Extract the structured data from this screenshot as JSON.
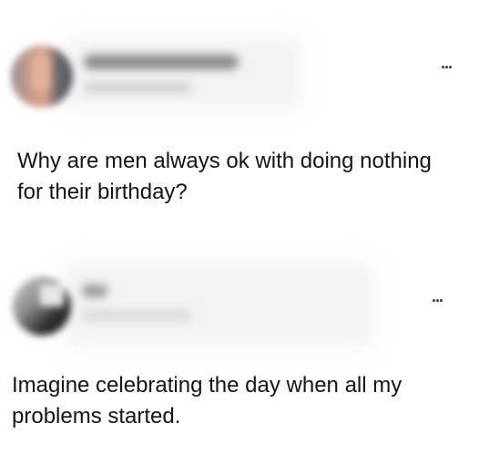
{
  "posts": [
    {
      "text": "Why are men always ok with doing nothing for their birthday?",
      "more_icon": "more-horizontal-icon",
      "more_symbol": "..."
    },
    {
      "text": "Imagine celebrating the day when all my problems started.",
      "more_icon": "more-horizontal-icon",
      "more_symbol": "..."
    }
  ]
}
